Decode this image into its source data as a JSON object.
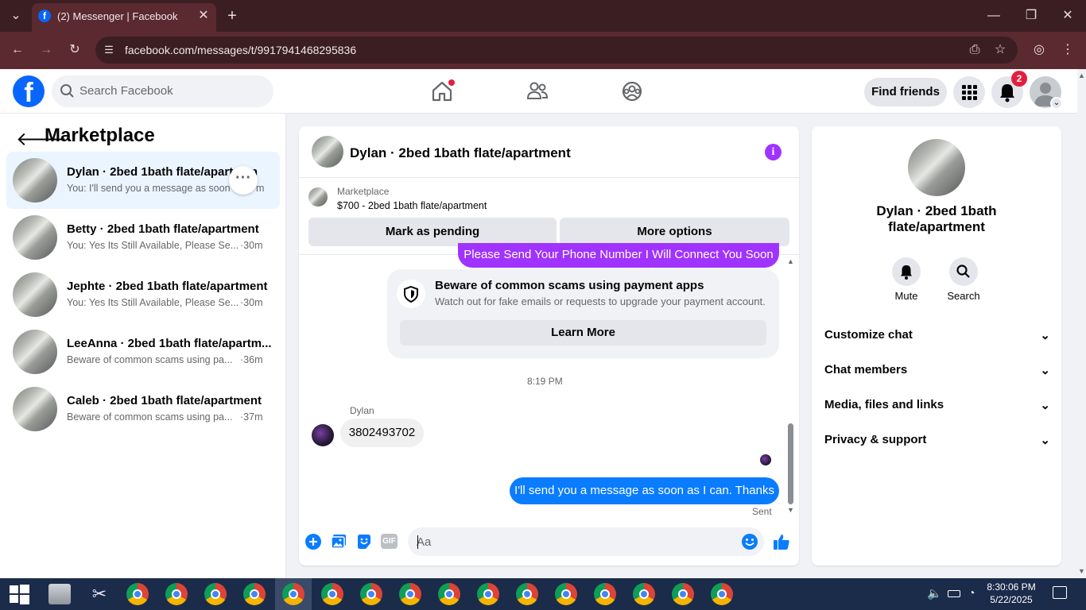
{
  "browser": {
    "tab_title": "(2) Messenger | Facebook",
    "url": "facebook.com/messages/t/9917941468295836"
  },
  "fb_header": {
    "search_placeholder": "Search Facebook",
    "find_friends": "Find friends",
    "notification_count": "2"
  },
  "left_panel": {
    "title": "Marketplace",
    "conversations": [
      {
        "name": "Dylan · 2bed 1bath flate/apartment",
        "preview": "You: I'll send you a message as soon",
        "time": "m",
        "active": true
      },
      {
        "name": "Betty · 2bed 1bath flate/apartment",
        "preview": "You: Yes Its Still Available, Please Se...",
        "time": "·30m"
      },
      {
        "name": "Jephte · 2bed 1bath flate/apartment",
        "preview": "You: Yes Its Still Available, Please Se...",
        "time": "·30m"
      },
      {
        "name": "LeeAnna · 2bed 1bath flate/apartm...",
        "preview": "Beware of common scams using pa...",
        "time": "·36m"
      },
      {
        "name": "Caleb · 2bed 1bath flate/apartment",
        "preview": "Beware of common scams using pa...",
        "time": "·37m"
      }
    ]
  },
  "chat": {
    "title": "Dylan · 2bed 1bath flate/apartment",
    "listing_source": "Marketplace",
    "listing_price": "$700 - 2bed 1bath flate/apartment",
    "mark_pending": "Mark as pending",
    "more_options": "More options",
    "partial_message": "Please Send Your Phone Number I Will Connect You Soon",
    "scam_title": "Beware of common scams using payment apps",
    "scam_desc": "Watch out for fake emails or requests to upgrade your payment account.",
    "learn_more": "Learn More",
    "timestamp": "8:19 PM",
    "sender": "Dylan",
    "incoming_message": "3802493702",
    "outgoing_message": "I'll send you a message as soon as I can. Thanks",
    "status": "Sent",
    "composer_placeholder": "Aa"
  },
  "right_panel": {
    "name": "Dylan · 2bed 1bath flate/apartment",
    "mute": "Mute",
    "search": "Search",
    "sections": [
      "Customize chat",
      "Chat members",
      "Media, files and links",
      "Privacy & support"
    ]
  },
  "taskbar": {
    "time": "8:30:06 PM",
    "date": "5/22/2025"
  },
  "colors": {
    "fb_blue": "#0866ff",
    "messenger_purple": "#a033ff",
    "outgoing_bubble": "#0a7cff"
  }
}
